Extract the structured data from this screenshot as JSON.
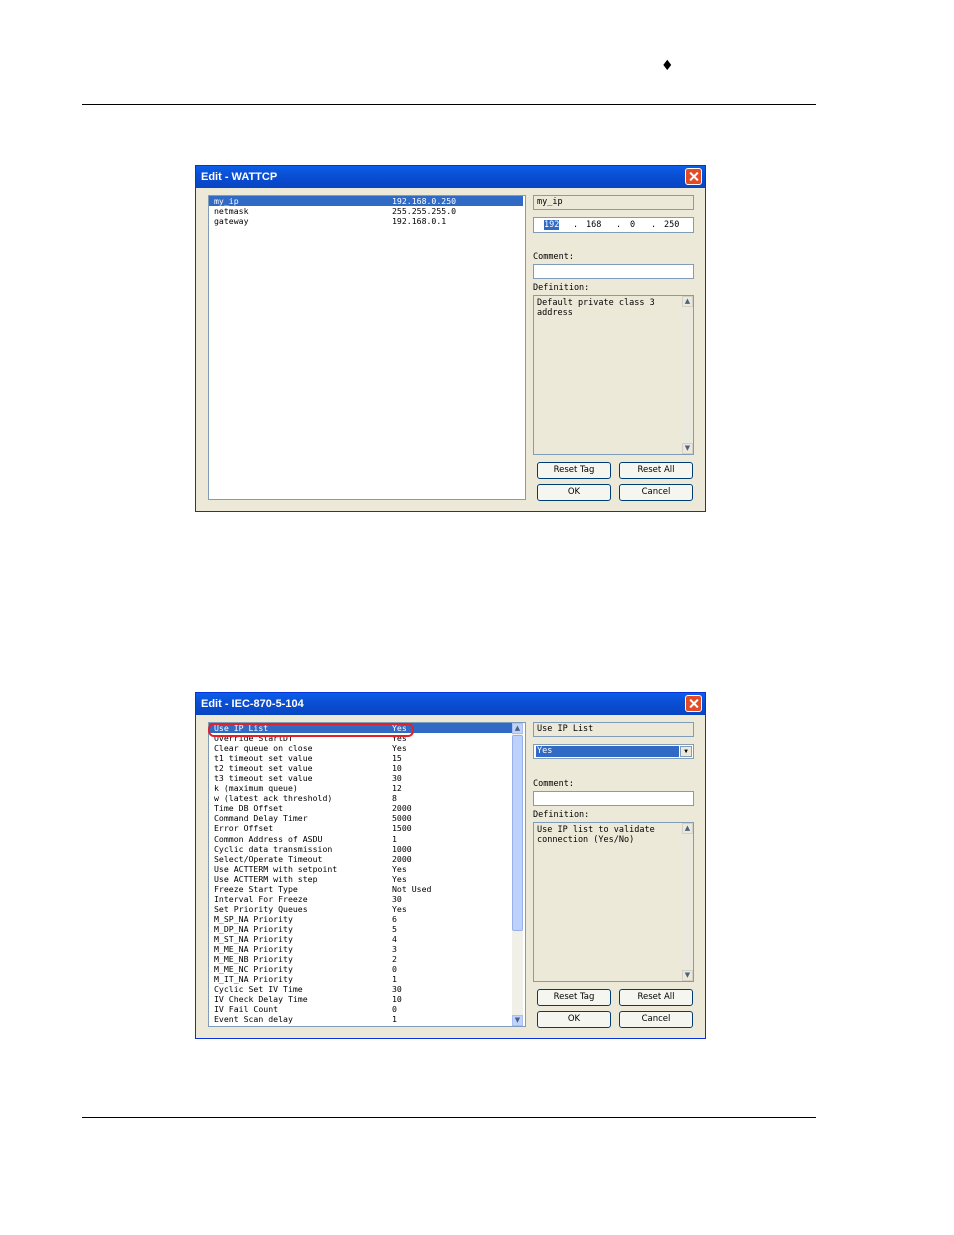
{
  "page": {
    "marker": "♦"
  },
  "dialog1": {
    "title": "Edit - WATTCP",
    "rows": [
      {
        "name": "my_ip",
        "value": "192.168.0.250"
      },
      {
        "name": "netmask",
        "value": "255.255.255.0"
      },
      {
        "name": "gateway",
        "value": "192.168.0.1"
      }
    ],
    "tag_name": "my_ip",
    "ip_octets": [
      "192",
      "168",
      "0",
      "250"
    ],
    "ip_dot": ".",
    "comment_label": "Comment:",
    "comment_value": "",
    "definition_label": "Definition:",
    "definition_text": "Default private class 3 address",
    "buttons": {
      "reset_tag": "Reset Tag",
      "reset_all": "Reset All",
      "ok": "OK",
      "cancel": "Cancel"
    }
  },
  "dialog2": {
    "title": "Edit - IEC-870-5-104",
    "rows": [
      {
        "name": "Use IP List",
        "value": "Yes"
      },
      {
        "name": "Override StartDT",
        "value": "Yes"
      },
      {
        "name": "Clear queue on close",
        "value": "Yes"
      },
      {
        "name": "t1 timeout set value",
        "value": "15"
      },
      {
        "name": "t2 timeout set value",
        "value": "10"
      },
      {
        "name": "t3 timeout set value",
        "value": "30"
      },
      {
        "name": "k (maximum queue)",
        "value": "12"
      },
      {
        "name": "w (latest ack threshold)",
        "value": "8"
      },
      {
        "name": "Time DB Offset",
        "value": "2000"
      },
      {
        "name": "Command Delay Timer",
        "value": "5000"
      },
      {
        "name": "Error Offset",
        "value": "1500"
      },
      {
        "name": "Common Address of ASDU",
        "value": "1"
      },
      {
        "name": "Cyclic data transmission",
        "value": "1000"
      },
      {
        "name": "Select/Operate Timeout",
        "value": "2000"
      },
      {
        "name": "Use ACTTERM with setpoint",
        "value": "Yes"
      },
      {
        "name": "Use ACTTERM with step",
        "value": "Yes"
      },
      {
        "name": "Freeze Start Type",
        "value": "Not Used"
      },
      {
        "name": "Interval For Freeze",
        "value": "30"
      },
      {
        "name": "Set Priority Queues",
        "value": "Yes"
      },
      {
        "name": "M_SP_NA Priority",
        "value": "6"
      },
      {
        "name": "M_DP_NA Priority",
        "value": "5"
      },
      {
        "name": "M_ST_NA Priority",
        "value": "4"
      },
      {
        "name": "M_ME_NA Priority",
        "value": "3"
      },
      {
        "name": "M_ME_NB Priority",
        "value": "2"
      },
      {
        "name": "M_ME_NC Priority",
        "value": "0"
      },
      {
        "name": "M_IT_NA Priority",
        "value": "1"
      },
      {
        "name": "Cyclic Set IV Time",
        "value": "30"
      },
      {
        "name": "IV Check Delay Time",
        "value": "10"
      },
      {
        "name": "IV Fail Count",
        "value": "0"
      },
      {
        "name": "Event Scan delay",
        "value": "1"
      }
    ],
    "tag_name": "Use IP List",
    "select_value": "Yes",
    "comment_label": "Comment:",
    "comment_value": "",
    "definition_label": "Definition:",
    "definition_text": "Use IP list to validate\nconnection (Yes/No)",
    "buttons": {
      "reset_tag": "Reset Tag",
      "reset_all": "Reset All",
      "ok": "OK",
      "cancel": "Cancel"
    }
  }
}
